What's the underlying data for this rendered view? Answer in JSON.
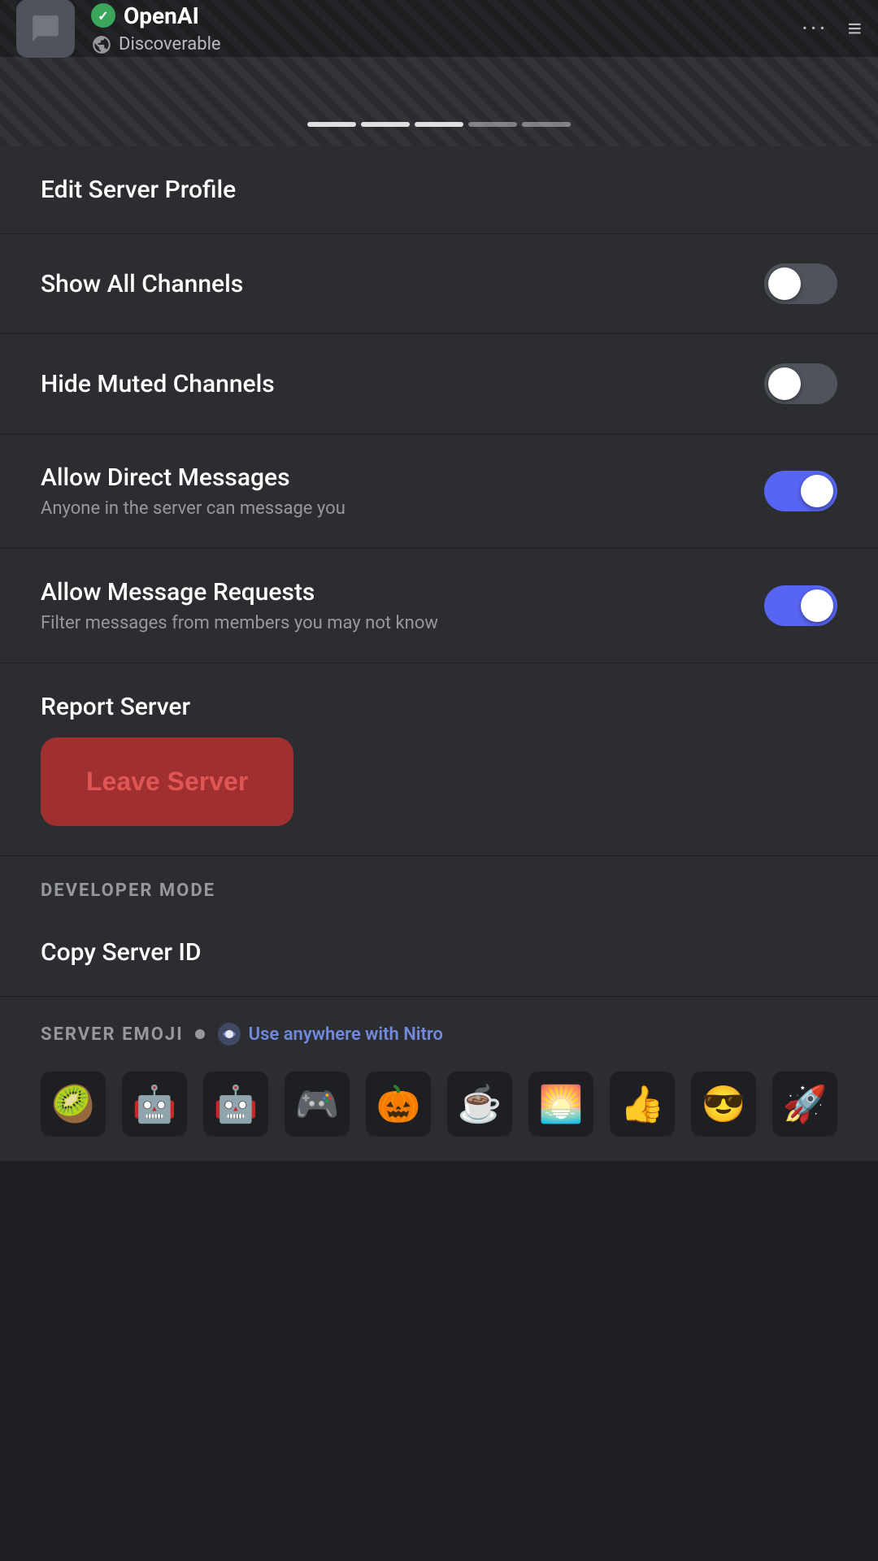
{
  "header": {
    "server_name": "OpenAI",
    "verified": true,
    "discoverable_label": "Discoverable",
    "more_options": "···",
    "hamburger": "≡",
    "progress_dots": [
      true,
      true,
      true,
      false,
      false
    ]
  },
  "menu_items": {
    "edit_server_profile": "Edit Server Profile",
    "show_all_channels": "Show All Channels",
    "show_all_channels_state": "off",
    "hide_muted_channels": "Hide Muted Channels",
    "hide_muted_channels_state": "off",
    "allow_direct_messages": "Allow Direct Messages",
    "allow_direct_messages_subtitle": "Anyone in the server can message you",
    "allow_direct_messages_state": "on",
    "allow_message_requests": "Allow Message Requests",
    "allow_message_requests_subtitle": "Filter messages from members you may not know",
    "allow_message_requests_state": "on",
    "report_server": "Report Server",
    "leave_server": "Leave Server",
    "developer_mode_label": "DEVELOPER MODE",
    "copy_server_id": "Copy Server ID",
    "server_emoji_label": "SERVER EMOJI",
    "nitro_link_text": "Use anywhere with Nitro",
    "emojis": [
      "🥝",
      "🤖",
      "🤖",
      "🎮",
      "🎃",
      "☕",
      "🌅",
      "👍",
      "😎",
      "🚀"
    ]
  }
}
